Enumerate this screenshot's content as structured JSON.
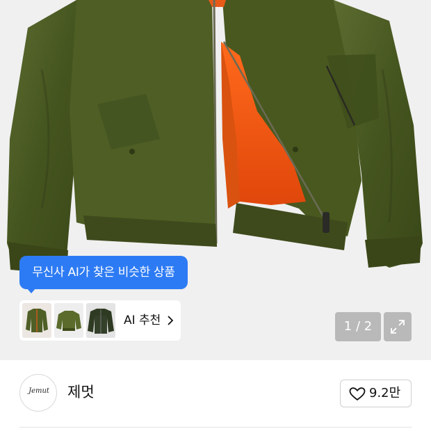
{
  "hero": {
    "image_alt": "olive green MA-1 bomber jacket with orange lining",
    "ai_bubble_text": "무신사 AI가 찾은 비슷한 상품",
    "ai_recommend_label": "AI 추천",
    "pager_text": "1 / 2",
    "expand_icon": "expand-icon"
  },
  "brand": {
    "logo_text": "Jemut",
    "name": "제멋",
    "like_count": "9.2만",
    "like_icon": "heart-icon"
  },
  "colors": {
    "accent": "#2d7bf4",
    "jacket": "#4a5a26",
    "lining": "#f05a14"
  }
}
